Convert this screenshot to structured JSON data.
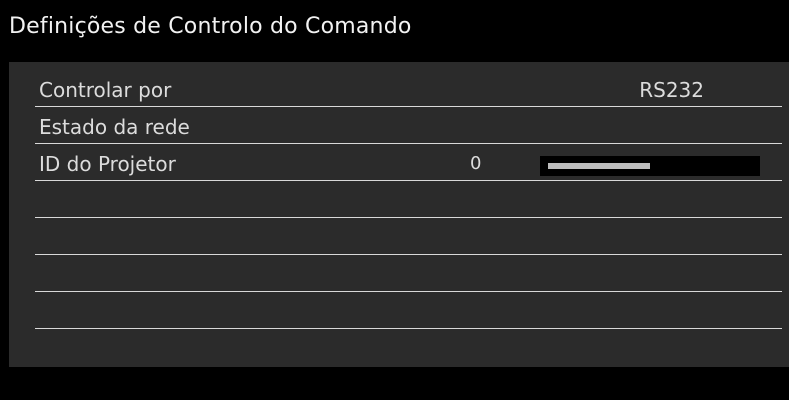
{
  "title": "Definições de Controlo do Comando",
  "rows": [
    {
      "label": "Controlar por",
      "value": "RS232"
    },
    {
      "label": "Estado da rede"
    },
    {
      "label": "ID do Projetor",
      "value": "0",
      "slider_fill_fraction": 0.5
    }
  ],
  "colors": {
    "background": "#000000",
    "panel": "#2b2b2b",
    "text": "#dcdcdc",
    "divider": "#d9d9d9",
    "slider_fill": "#bdbdbd"
  }
}
